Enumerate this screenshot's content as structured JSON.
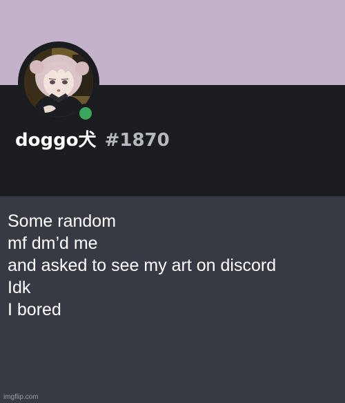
{
  "profile": {
    "username": "doggo犬",
    "discriminator": "#1870",
    "status": "online",
    "avatar_icon": "anime-girl-avatar-icon"
  },
  "colors": {
    "banner": "#c2b2ca",
    "header_bg": "#1b1c1f",
    "body_bg": "#373a43",
    "status_online": "#3ba55c",
    "tag_text": "#b5b9bf"
  },
  "message": {
    "lines": [
      "Some random",
      "mf dm’d me",
      "and asked to see my art on discord",
      "Idk",
      "I bored"
    ]
  },
  "watermark": "imgflip.com"
}
